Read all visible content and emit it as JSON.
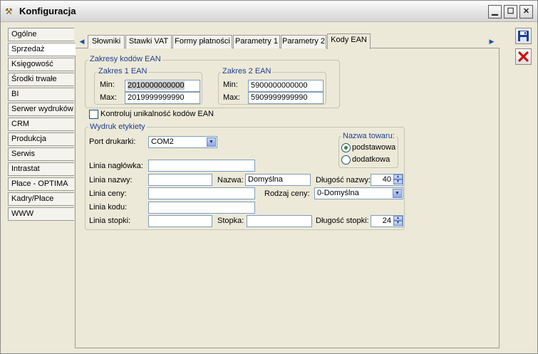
{
  "window": {
    "title": "Konfiguracja",
    "app_icon": "tools-icon"
  },
  "left_tabs": [
    {
      "label": "Ogólne",
      "active": false
    },
    {
      "label": "Sprzedaż",
      "active": true
    },
    {
      "label": "Księgowość",
      "active": false
    },
    {
      "label": "Środki trwałe",
      "active": false
    },
    {
      "label": "BI",
      "active": false
    },
    {
      "label": "Serwer wydruków",
      "active": false
    },
    {
      "label": "CRM",
      "active": false
    },
    {
      "label": "Produkcja",
      "active": false
    },
    {
      "label": "Serwis",
      "active": false
    },
    {
      "label": "Intrastat",
      "active": false
    },
    {
      "label": "Płace - OPTIMA",
      "active": false
    },
    {
      "label": "Kadry/Płace",
      "active": false
    },
    {
      "label": "WWW",
      "active": false
    }
  ],
  "top_tabs": [
    {
      "label": "Słowniki"
    },
    {
      "label": "Stawki VAT"
    },
    {
      "label": "Formy płatności"
    },
    {
      "label": "Parametry 1"
    },
    {
      "label": "Parametry 2"
    },
    {
      "label": "Kody EAN",
      "active": true
    }
  ],
  "ean": {
    "group_title": "Zakresy kodów EAN",
    "range1": {
      "title": "Zakres 1 EAN",
      "min_label": "Min:",
      "min": "2010000000000",
      "max_label": "Max:",
      "max": "2019999999990"
    },
    "range2": {
      "title": "Zakres 2 EAN",
      "min_label": "Min:",
      "min": "5900000000000",
      "max_label": "Max:",
      "max": "5909999999990"
    },
    "unique_check_label": "Kontroluj unikalność kodów EAN",
    "unique_checked": false
  },
  "label_print": {
    "group_title": "Wydruk etykiety",
    "port_label": "Port drukarki:",
    "port_value": "COM2",
    "product_name": {
      "title": "Nazwa towaru:",
      "options": [
        "podstawowa",
        "dodatkowa"
      ],
      "selected": "podstawowa"
    },
    "header_line_label": "Linia nagłówka:",
    "header_line": "",
    "name_line_label": "Linia nazwy:",
    "name_line": "",
    "name_label": "Nazwa:",
    "name_value": "Domyślna",
    "name_length_label": "Długość nazwy:",
    "name_length": "40",
    "price_line_label": "Linia ceny:",
    "price_line": "",
    "price_type_label": "Rodzaj ceny:",
    "price_type": "0-Domyślna",
    "code_line_label": "Linia kodu:",
    "code_line": "",
    "footer_line_label": "Linia stopki:",
    "footer_line": "",
    "footer_label": "Stopka:",
    "footer_value": "",
    "footer_length_label": "Długość stopki:",
    "footer_length": "24"
  },
  "colors": {
    "accent": "#1f3d8f",
    "save_icon": "#1a3f9c",
    "cancel_icon": "#cc1111"
  }
}
